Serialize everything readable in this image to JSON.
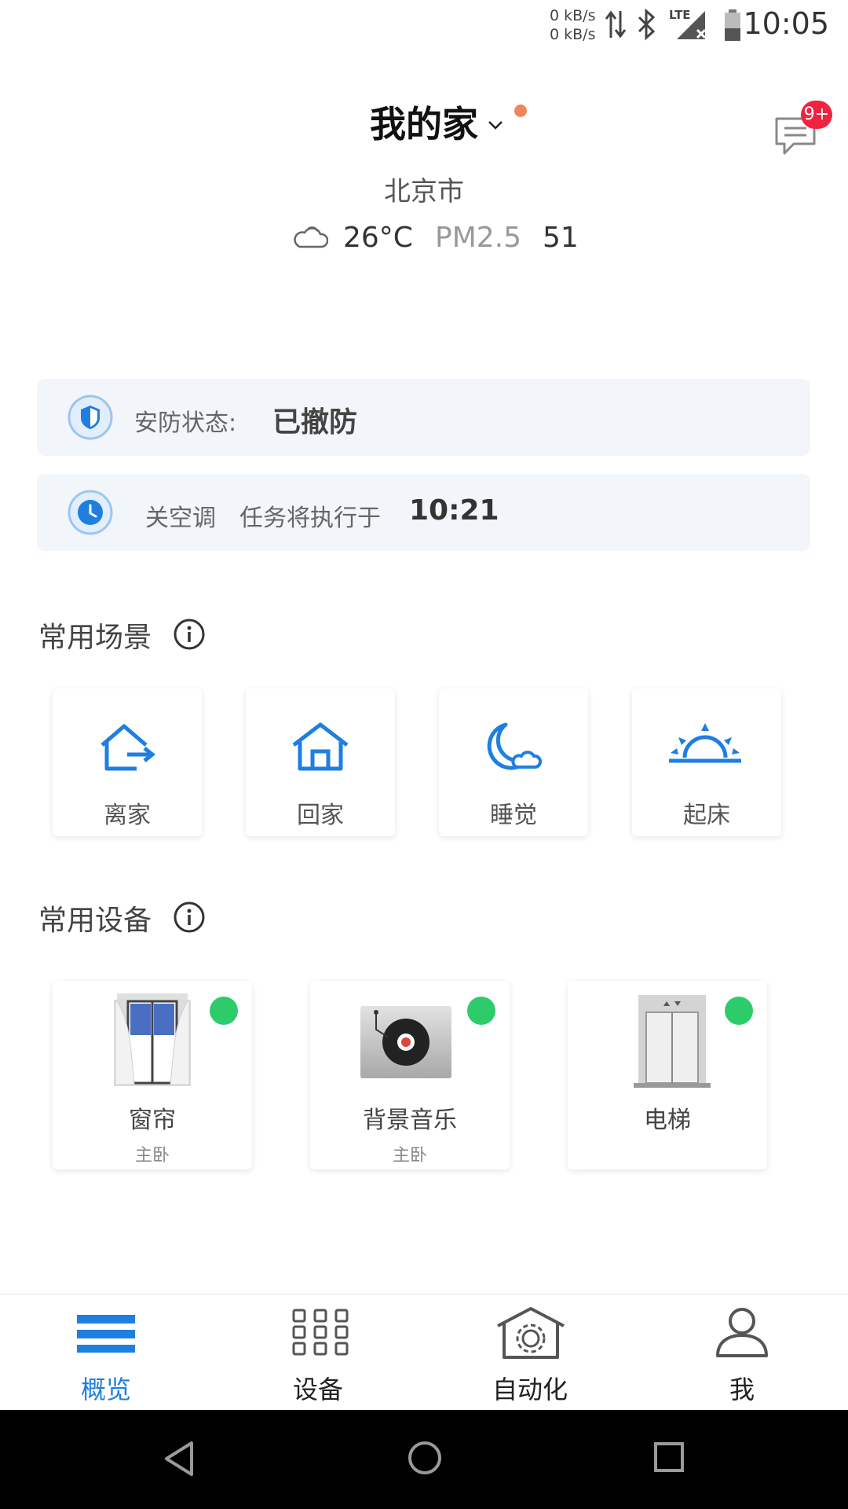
{
  "status_bar": {
    "net_up": "0 kB/s",
    "net_down": "0 kB/s",
    "network_type": "LTE",
    "time": "10:05"
  },
  "header": {
    "home_name": "我的家",
    "message_badge": "9+",
    "city": "北京市",
    "temperature": "26°C",
    "pm_label": "PM2.5",
    "pm_value": "51"
  },
  "security": {
    "label": "安防状态:",
    "status": "已撤防"
  },
  "task": {
    "name": "关空调",
    "text": "任务将执行于",
    "time": "10:21"
  },
  "scenes": {
    "title": "常用场景",
    "items": [
      {
        "label": "离家",
        "icon": "leave-home-icon"
      },
      {
        "label": "回家",
        "icon": "home-icon"
      },
      {
        "label": "睡觉",
        "icon": "moon-cloud-icon"
      },
      {
        "label": "起床",
        "icon": "sunrise-icon"
      }
    ]
  },
  "devices": {
    "title": "常用设备",
    "items": [
      {
        "name": "窗帘",
        "room": "主卧",
        "status_color": "#2dcc6a"
      },
      {
        "name": "背景音乐",
        "room": "主卧",
        "status_color": "#2dcc6a"
      },
      {
        "name": "电梯",
        "room": "",
        "status_color": "#2dcc6a"
      }
    ]
  },
  "bottom_nav": {
    "items": [
      {
        "label": "概览",
        "active": true
      },
      {
        "label": "设备",
        "active": false
      },
      {
        "label": "自动化",
        "active": false
      },
      {
        "label": "我",
        "active": false
      }
    ]
  },
  "colors": {
    "accent": "#1e7fe0",
    "online": "#2dcc6a",
    "badge": "#f2233f",
    "title_dot": "#f0855a"
  }
}
